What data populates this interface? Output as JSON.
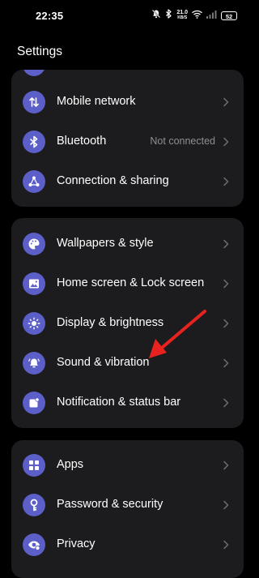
{
  "status_bar": {
    "time": "22:35",
    "net_speed_value": "21.0",
    "net_speed_unit": "KB/S",
    "battery": "52",
    "icons": [
      "silent-icon",
      "bluetooth-icon",
      "net-speed",
      "wifi-icon",
      "signal-icon",
      "battery-icon"
    ]
  },
  "header": {
    "title": "Settings"
  },
  "group1": {
    "items": [
      {
        "label": "Mobile network",
        "value": "",
        "icon": "mobile-network-icon"
      },
      {
        "label": "Bluetooth",
        "value": "Not connected",
        "icon": "bluetooth-icon"
      },
      {
        "label": "Connection & sharing",
        "value": "",
        "icon": "connection-sharing-icon"
      }
    ]
  },
  "group2": {
    "items": [
      {
        "label": "Wallpapers & style",
        "value": "",
        "icon": "palette-icon"
      },
      {
        "label": "Home screen & Lock screen",
        "value": "",
        "icon": "image-icon"
      },
      {
        "label": "Display & brightness",
        "value": "",
        "icon": "brightness-icon"
      },
      {
        "label": "Sound & vibration",
        "value": "",
        "icon": "bell-icon"
      },
      {
        "label": "Notification & status bar",
        "value": "",
        "icon": "notification-icon"
      }
    ]
  },
  "group3": {
    "items": [
      {
        "label": "Apps",
        "value": "",
        "icon": "apps-grid-icon"
      },
      {
        "label": "Password & security",
        "value": "",
        "icon": "key-icon"
      },
      {
        "label": "Privacy",
        "value": "",
        "icon": "privacy-eye-icon"
      }
    ]
  },
  "colors": {
    "background": "#000000",
    "card": "#1c1c1e",
    "icon_accent": "#5b5fc7",
    "secondary_text": "#8e8e93",
    "annotation_arrow": "#e8231f"
  }
}
